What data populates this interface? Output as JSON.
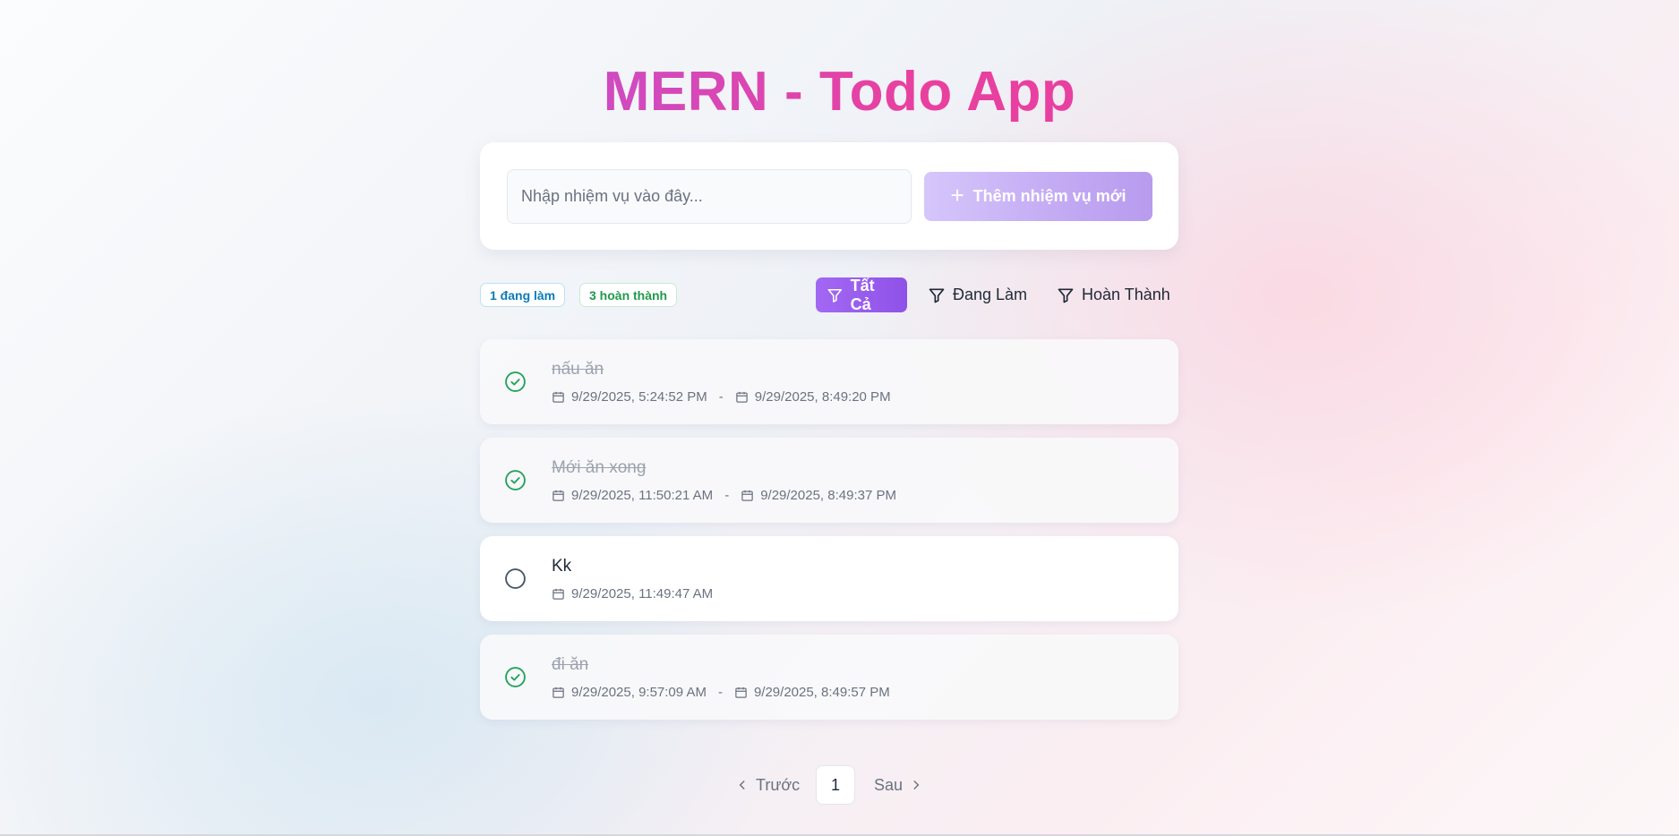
{
  "header": {
    "title": "MERN - Todo App"
  },
  "add_task": {
    "placeholder": "Nhập nhiệm vụ vào đây...",
    "button_label": "Thêm nhiệm vụ mới"
  },
  "stats": {
    "active": "1 đang làm",
    "completed": "3 hoàn thành"
  },
  "filters": [
    {
      "label": "Tất Cả",
      "selected": true
    },
    {
      "label": "Đang Làm",
      "selected": false
    },
    {
      "label": "Hoàn Thành",
      "selected": false
    }
  ],
  "tasks": [
    {
      "title": "nấu ăn",
      "completed": true,
      "created": "9/29/2025, 5:24:52 PM",
      "separator": "-",
      "completed_at": "9/29/2025, 8:49:20 PM"
    },
    {
      "title": "Mới ăn xong",
      "completed": true,
      "created": "9/29/2025, 11:50:21 AM",
      "separator": "-",
      "completed_at": "9/29/2025, 8:49:37 PM"
    },
    {
      "title": "Kk",
      "completed": false,
      "created": "9/29/2025, 11:49:47 AM"
    },
    {
      "title": "đi ăn",
      "completed": true,
      "created": "9/29/2025, 9:57:09 AM",
      "separator": "-",
      "completed_at": "9/29/2025, 8:49:57 PM"
    }
  ],
  "pagination": {
    "prev_label": "Trước",
    "current_page": "1",
    "next_label": "Sau"
  },
  "colors": {
    "accent_purple": "#9b5cf0",
    "accent_pink": "#e9409f",
    "done_green": "#22a35a",
    "active_blue": "#0b7bb8"
  }
}
